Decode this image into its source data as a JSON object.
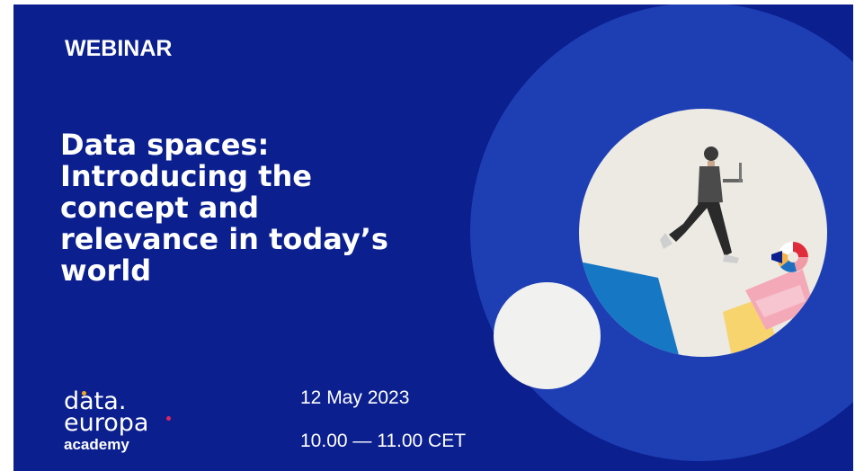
{
  "slide": {
    "label": "WEBINAR",
    "title_lines": [
      "Data spaces:",
      "Introducing the",
      "concept and",
      "relevance in today’s",
      "world"
    ],
    "date": "12 May 2023",
    "time": "10.00 — 11.00 CET"
  },
  "logo": {
    "line1": "data.",
    "line2": "europa",
    "line3": "academy",
    "dot_colors": [
      "#f5a623",
      "#e0245e"
    ]
  },
  "colors": {
    "background": "#0b1f8f",
    "circle_large": "#1e3fb4",
    "circle_photo": "#eceae3",
    "circle_small": "#f1f1ef",
    "text": "#ffffff"
  },
  "icons": {
    "illustration": "running-man-with-laptop"
  }
}
